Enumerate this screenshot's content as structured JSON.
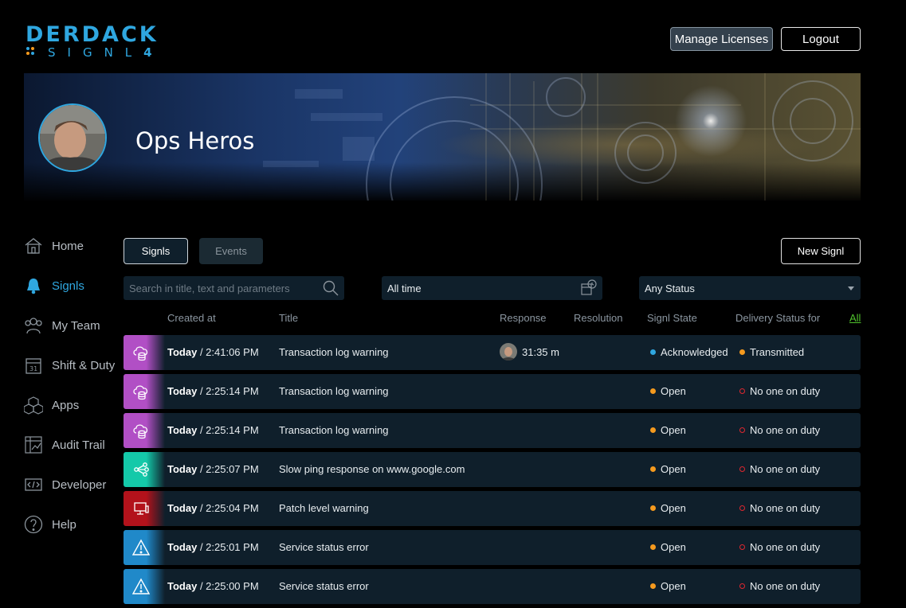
{
  "logo": {
    "word": "DERDACK",
    "sub": "SIGNL",
    "version": "4"
  },
  "header": {
    "manage_licenses": "Manage Licenses",
    "logout": "Logout"
  },
  "team": {
    "name": "Ops Heros"
  },
  "sidebar": {
    "items": [
      {
        "label": "Home",
        "icon": "home-icon"
      },
      {
        "label": "Signls",
        "icon": "bell-icon",
        "active": true
      },
      {
        "label": "My Team",
        "icon": "team-icon"
      },
      {
        "label": "Shift & Duty",
        "icon": "calendar-icon"
      },
      {
        "label": "Apps",
        "icon": "cubes-icon"
      },
      {
        "label": "Audit Trail",
        "icon": "audit-chart-icon"
      },
      {
        "label": "Developer",
        "icon": "code-icon"
      },
      {
        "label": "Help",
        "icon": "help-icon"
      }
    ]
  },
  "tabs": {
    "signls": "Signls",
    "events": "Events"
  },
  "new_signl": "New Signl",
  "filters": {
    "search_placeholder": "Search in title, text and parameters",
    "time": "All time",
    "status": "Any Status"
  },
  "columns": {
    "created_at": "Created at",
    "title": "Title",
    "response": "Response",
    "resolution": "Resolution",
    "state": "Signl State",
    "delivery": "Delivery Status for",
    "all": "All"
  },
  "colors": {
    "accent": "#2fa7e0",
    "open": "#f59a1e",
    "no_duty": "#e0272f",
    "link": "#4fc12c"
  },
  "rows": [
    {
      "type": "cloud-database-icon",
      "color": "#b14fc5",
      "day": "Today",
      "time": " / 2:41:06 PM",
      "title": "Transaction log warning",
      "response": "31:35 m",
      "state": "Acknowledged",
      "delivery": "Transmitted"
    },
    {
      "type": "cloud-database-icon",
      "color": "#b14fc5",
      "day": "Today",
      "time": " / 2:25:14 PM",
      "title": "Transaction log warning",
      "response": "",
      "state": "Open",
      "delivery": "No one on duty"
    },
    {
      "type": "cloud-database-icon",
      "color": "#b14fc5",
      "day": "Today",
      "time": " / 2:25:14 PM",
      "title": "Transaction log warning",
      "response": "",
      "state": "Open",
      "delivery": "No one on duty"
    },
    {
      "type": "network-nodes-icon",
      "color": "#14c9a9",
      "day": "Today",
      "time": " / 2:25:07 PM",
      "title": "Slow ping response on www.google.com",
      "response": "",
      "state": "Open",
      "delivery": "No one on duty"
    },
    {
      "type": "monitor-icon",
      "color": "#b3121b",
      "day": "Today",
      "time": " / 2:25:04 PM",
      "title": "Patch level warning",
      "response": "",
      "state": "Open",
      "delivery": "No one on duty"
    },
    {
      "type": "warning-triangle-icon",
      "color": "#2089c9",
      "day": "Today",
      "time": " / 2:25:01 PM",
      "title": "Service status error",
      "response": "",
      "state": "Open",
      "delivery": "No one on duty"
    },
    {
      "type": "warning-triangle-icon",
      "color": "#2089c9",
      "day": "Today",
      "time": " / 2:25:00 PM",
      "title": "Service status error",
      "response": "",
      "state": "Open",
      "delivery": "No one on duty"
    }
  ]
}
